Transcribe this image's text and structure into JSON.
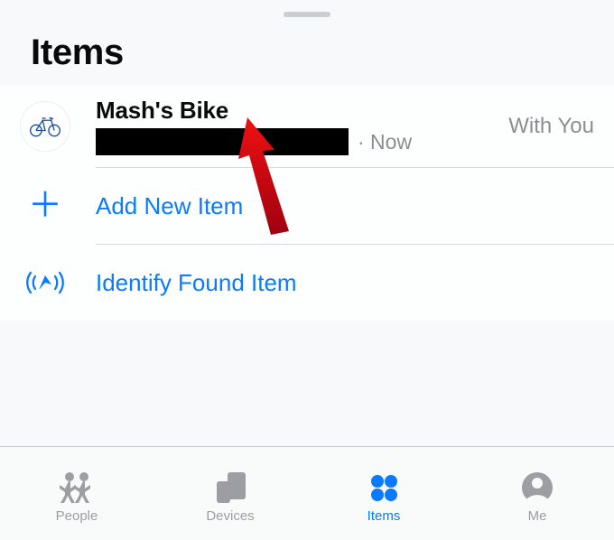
{
  "header": {
    "title": "Items"
  },
  "item": {
    "name": "Mash's Bike",
    "time_suffix": "· Now",
    "status": "With You"
  },
  "actions": {
    "add_label": "Add New Item",
    "identify_label": "Identify Found Item"
  },
  "tabs": {
    "people": "People",
    "devices": "Devices",
    "items": "Items",
    "me": "Me"
  }
}
